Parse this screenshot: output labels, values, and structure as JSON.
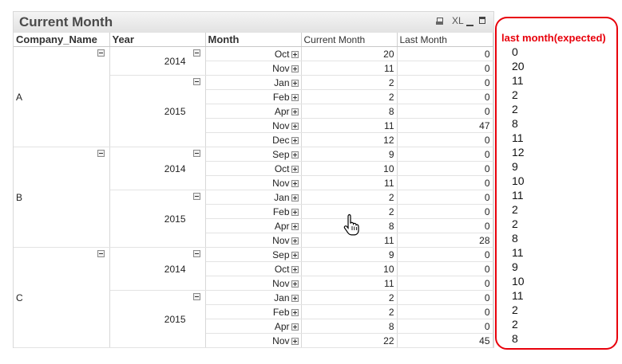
{
  "panel": {
    "title": "Current Month",
    "toolbar": {
      "xl_label": "XL"
    }
  },
  "table": {
    "headers": [
      "Company_Name",
      "Year",
      "Month",
      "Current Month",
      "Last Month"
    ],
    "groups": [
      {
        "company": "A",
        "years": [
          {
            "year": "2014",
            "months": [
              {
                "month": "Oct",
                "current": "20",
                "last": "0"
              },
              {
                "month": "Nov",
                "current": "11",
                "last": "0"
              }
            ]
          },
          {
            "year": "2015",
            "months": [
              {
                "month": "Jan",
                "current": "2",
                "last": "0"
              },
              {
                "month": "Feb",
                "current": "2",
                "last": "0"
              },
              {
                "month": "Apr",
                "current": "8",
                "last": "0"
              },
              {
                "month": "Nov",
                "current": "11",
                "last": "47"
              },
              {
                "month": "Dec",
                "current": "12",
                "last": "0"
              }
            ]
          }
        ]
      },
      {
        "company": "B",
        "years": [
          {
            "year": "2014",
            "months": [
              {
                "month": "Sep",
                "current": "9",
                "last": "0"
              },
              {
                "month": "Oct",
                "current": "10",
                "last": "0"
              },
              {
                "month": "Nov",
                "current": "11",
                "last": "0"
              }
            ]
          },
          {
            "year": "2015",
            "months": [
              {
                "month": "Jan",
                "current": "2",
                "last": "0"
              },
              {
                "month": "Feb",
                "current": "2",
                "last": "0"
              },
              {
                "month": "Apr",
                "current": "8",
                "last": "0"
              },
              {
                "month": "Nov",
                "current": "11",
                "last": "28"
              }
            ]
          }
        ]
      },
      {
        "company": "C",
        "years": [
          {
            "year": "2014",
            "months": [
              {
                "month": "Sep",
                "current": "9",
                "last": "0"
              },
              {
                "month": "Oct",
                "current": "10",
                "last": "0"
              },
              {
                "month": "Nov",
                "current": "11",
                "last": "0"
              }
            ]
          },
          {
            "year": "2015",
            "months": [
              {
                "month": "Jan",
                "current": "2",
                "last": "0"
              },
              {
                "month": "Feb",
                "current": "2",
                "last": "0"
              },
              {
                "month": "Apr",
                "current": "8",
                "last": "0"
              },
              {
                "month": "Nov",
                "current": "22",
                "last": "45"
              }
            ]
          }
        ]
      }
    ]
  },
  "expected": {
    "title": "last month(expected)",
    "values": [
      "0",
      "20",
      "11",
      "2",
      "2",
      "8",
      "11",
      "12",
      "9",
      "10",
      "11",
      "2",
      "2",
      "8",
      "11",
      "9",
      "10",
      "11",
      "2",
      "2",
      "8"
    ]
  },
  "colors": {
    "annotation_red": "#e8000b"
  }
}
